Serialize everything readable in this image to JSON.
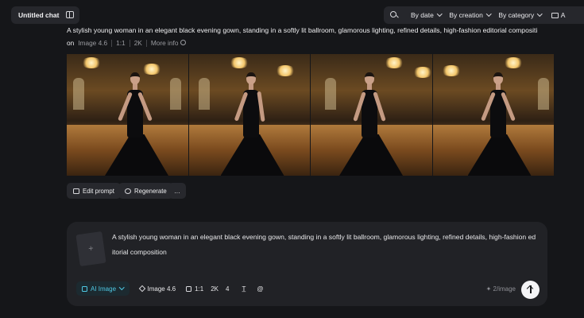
{
  "header": {
    "chat_title": "Untitled chat",
    "filters": [
      "By date",
      "By creation",
      "By category",
      "A"
    ]
  },
  "result": {
    "prompt": "A stylish young woman in an elegant black evening gown, standing in a softly lit ballroom, glamorous lighting, refined details, high-fashion editorial compositi",
    "on_label": "on",
    "model": "Image 4.6",
    "ratio": "1:1",
    "resolution": "2K",
    "more_info": "More info",
    "image_count": 4,
    "actions": {
      "edit": "Edit prompt",
      "regenerate": "Regenerate",
      "more": "…"
    }
  },
  "composer": {
    "text": "A stylish young woman in an elegant black evening gown, standing in a softly lit ballroom, glamorous lighting, refined details, high-fashion editorial composition",
    "mode": "AI Image",
    "model": "Image 4.6",
    "ratio": "1:1",
    "resolution": "2K",
    "count": "4",
    "credits": "2/image"
  },
  "colors": {
    "accent": "#4fc9e4",
    "background": "#151619",
    "panel": "#212226"
  },
  "icons": [
    "sidebar-icon",
    "search-icon",
    "folder-icon",
    "info-icon",
    "edit-icon",
    "regenerate-icon",
    "image-icon",
    "model-icon",
    "ratio-icon",
    "text-style-icon",
    "at-icon",
    "spark-icon",
    "send-icon",
    "add-icon"
  ]
}
